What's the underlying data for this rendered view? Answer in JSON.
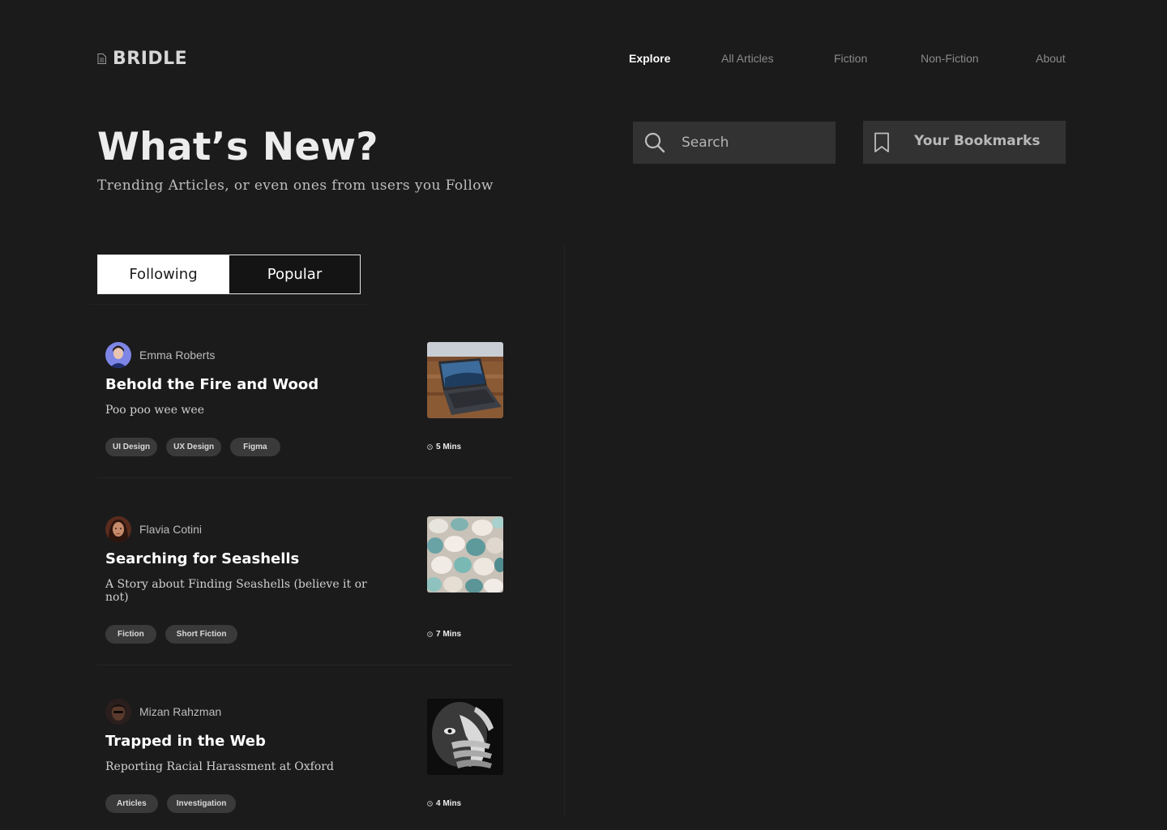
{
  "app": {
    "logo_text": "BRIDLE"
  },
  "nav": {
    "items": [
      {
        "label": "Explore",
        "active": true
      },
      {
        "label": "All Articles",
        "active": false
      },
      {
        "label": "Fiction",
        "active": false
      },
      {
        "label": "Non-Fiction",
        "active": false
      },
      {
        "label": "About",
        "active": false
      }
    ]
  },
  "hero": {
    "title": "What’s New?",
    "subtitle": "Trending Articles, or even ones from users you Follow"
  },
  "search": {
    "placeholder": "Search",
    "icon": "search-icon"
  },
  "bookmarks": {
    "label": "Your Bookmarks",
    "icon": "bookmark-icon"
  },
  "tabs": [
    {
      "label": "Following",
      "selected": true
    },
    {
      "label": "Popular",
      "selected": false
    }
  ],
  "articles": [
    {
      "author": "Emma Roberts",
      "title": "Behold the Fire and Wood",
      "description": "Poo poo wee wee",
      "tags": [
        "UI Design",
        "UX Design",
        "Figma"
      ],
      "read_time": "5 Mins",
      "thumbnail": "laptop-photo"
    },
    {
      "author": "Flavia Cotini",
      "title": "Searching for Seashells",
      "description": "A Story about Finding Seashells (believe it or not)",
      "tags": [
        "Fiction",
        "Short Fiction"
      ],
      "read_time": "7 Mins",
      "thumbnail": "seashells-photo"
    },
    {
      "author": "Mizan Rahzman",
      "title": "Trapped in the Web",
      "description": "Reporting Racial Harassment at Oxford",
      "tags": [
        "Articles",
        "Investigation"
      ],
      "read_time": "4 Mins",
      "thumbnail": "hands-over-face-photo"
    }
  ],
  "colors": {
    "background": "#1b1b1c",
    "panel": "#323233",
    "tag": "#3a3a3b",
    "text_primary": "#ffffff",
    "text_muted": "#8a8a8a"
  }
}
